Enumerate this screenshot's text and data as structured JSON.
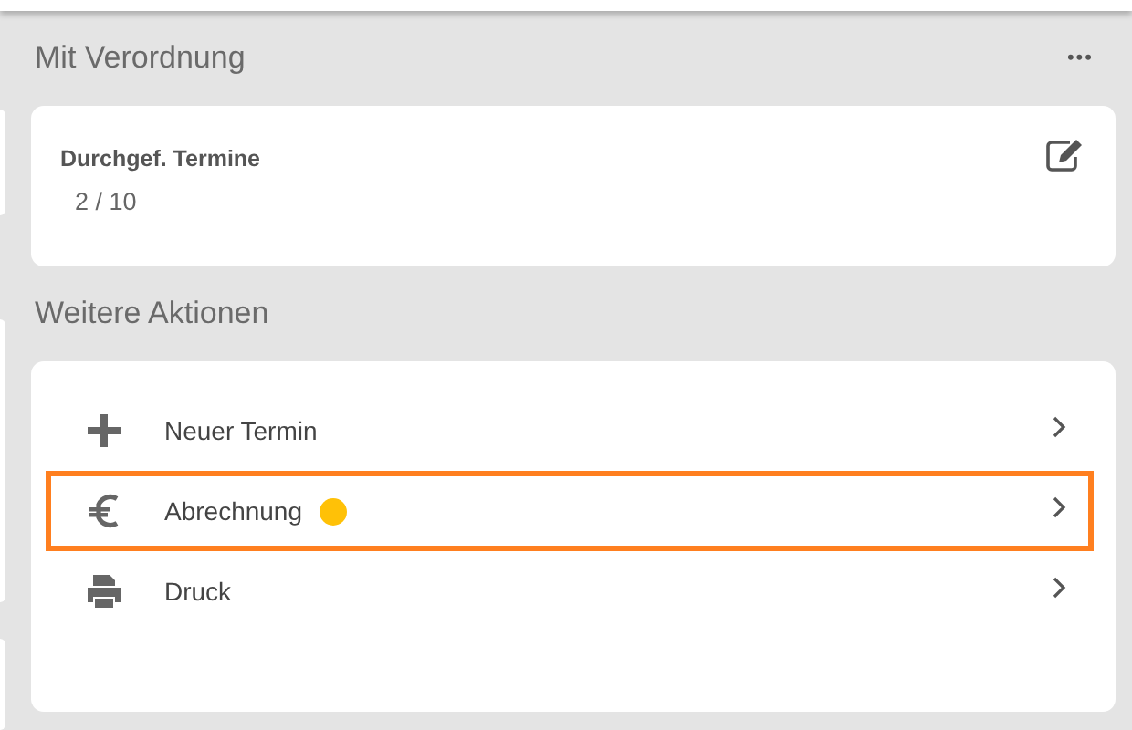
{
  "prescription": {
    "title": "Mit Verordnung",
    "menu": "•••",
    "card": {
      "label": "Durchgef. Termine",
      "value": "2 / 10"
    }
  },
  "actions": {
    "title": "Weitere Aktionen",
    "items": [
      {
        "kind": "plus",
        "label": "Neuer Termin",
        "selected": false
      },
      {
        "kind": "euro",
        "label": "Abrechnung",
        "selected": true,
        "dot": {
          "color": "#ffc107"
        }
      },
      {
        "kind": "printer",
        "label": "Druck",
        "selected": false
      }
    ]
  }
}
